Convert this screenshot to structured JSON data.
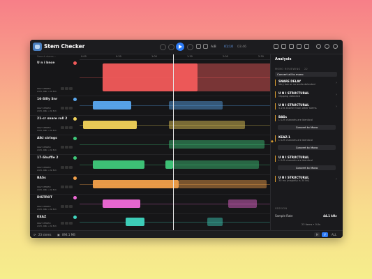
{
  "app": {
    "title": "Stem Checker"
  },
  "transport": {
    "current_time": "01:10",
    "total_time": "03:46",
    "ab_label": "A/B"
  },
  "search": {
    "placeholder": "Search stems..."
  },
  "ruler": {
    "labels": [
      "0:00",
      "0:30",
      "1:00",
      "1:30",
      "2:00",
      "2:30"
    ]
  },
  "tracks": [
    {
      "name": "U n i bnce",
      "sub1": "WAV STEREO",
      "sub2": "24 B, 48k • 2k 8ch",
      "color": "#f25a5a",
      "solo_color": "#f25a5a"
    },
    {
      "name": "16-Silly Snr",
      "sub1": "WAV STEREO",
      "sub2": "24 B, 48k • 2k 8ch",
      "color": "#5aa8f0",
      "solo_color": "#5aa8f0"
    },
    {
      "name": "21-cr snare roll 2",
      "sub1": "WAV STEREO",
      "sub2": "24 B, 48k • 2k 8ch",
      "color": "#f2d35a",
      "solo_color": "#f2d35a"
    },
    {
      "name": "Alki strings",
      "sub1": "WAV STEREO",
      "sub2": "24 B, 48k • 2k 8ch",
      "color": "#3fc87a",
      "solo_color": "#3fc87a"
    },
    {
      "name": "17-Shuffle 2",
      "sub1": "WAV STEREO",
      "sub2": "24 B, 48k • 2k 8ch",
      "color": "#3fc87a",
      "solo_color": "#3fc87a"
    },
    {
      "name": "BASs",
      "sub1": "WAV STEREO",
      "sub2": "24 B, 48k • 2k 8ch",
      "color": "#f2a04a",
      "solo_color": "#f2a04a"
    },
    {
      "name": "DISTROT",
      "sub1": "WAV STEREO",
      "sub2": "24 B, 48k • 2k 8ch",
      "color": "#f06ad8",
      "solo_color": "#f06ad8"
    },
    {
      "name": "KEAZ",
      "sub1": "WAV STEREO",
      "sub2": "24 B, 48k • 2k 8ch",
      "color": "#3fd6c0",
      "solo_color": "#3fd6c0"
    }
  ],
  "sidebar": {
    "title": "Analysis",
    "section1": "MONO REVIEWING",
    "section1_count": "22",
    "convert_all": "Convert all to mono",
    "cards": [
      {
        "title": "SNARE DELAY",
        "desc": "Very low or no audio detected"
      },
      {
        "title": "U N I STRUCTURAL",
        "desc": "Clipping detected"
      },
      {
        "title": "U N I STRUCTURAL",
        "desc": "5.25s shorter than other stems"
      },
      {
        "title": "BASs",
        "desc": "L & R channels are identical",
        "button": "Convert to Mono"
      },
      {
        "title": "KEAZ-1",
        "desc": "L & R channels are identical",
        "button": "Convert to Mono"
      },
      {
        "title": "U N I STRUCTURAL",
        "desc": "L & R channels are identical",
        "button": "Convert to Mono"
      },
      {
        "title": "U N I STRUCTURAL",
        "desc": "30 ms (majority is 34 lkf)"
      }
    ],
    "section2": "SESSION",
    "sample_rate_label": "Sample Rate",
    "sample_rate_value": "44.1 kHz",
    "footer_count": "23 items • 0.0s"
  },
  "status": {
    "stems": "23 stems",
    "size": "894.1 MB",
    "view_left": "H",
    "view_right": "V",
    "all": "ALL"
  },
  "colors": {
    "accent": "#2e7cf6",
    "warning": "#d79a2e",
    "background": "#161618"
  }
}
